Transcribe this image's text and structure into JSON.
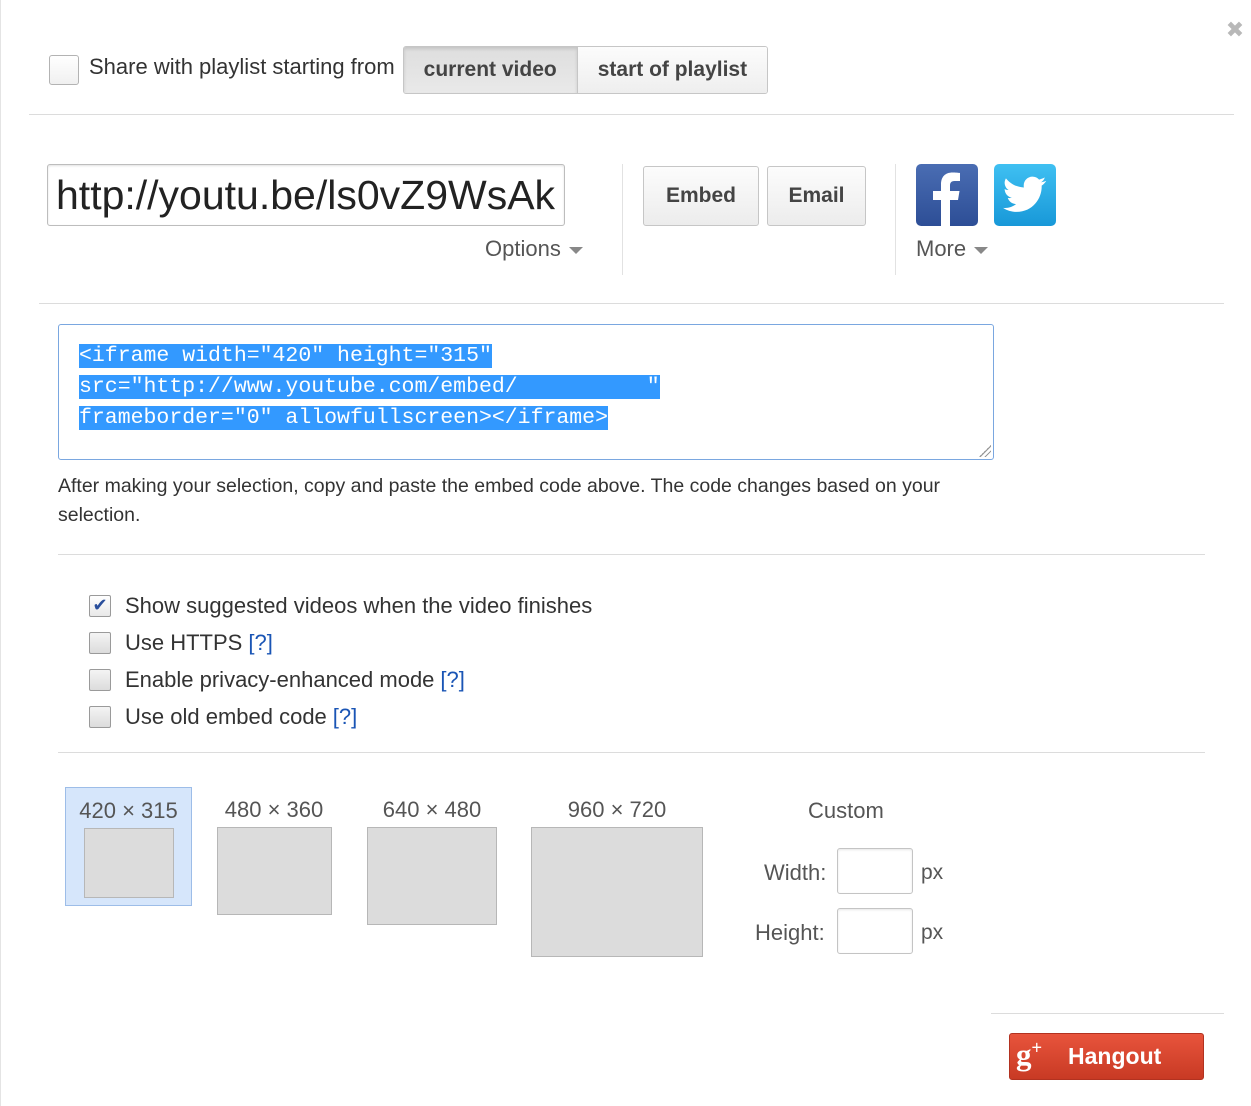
{
  "playlist": {
    "label": "Share with playlist starting from",
    "options": [
      "current video",
      "start of playlist"
    ],
    "selected": "current video"
  },
  "share": {
    "url": "http://youtu.be/ls0vZ9WsAk",
    "options_label": "Options",
    "embed_label": "Embed",
    "email_label": "Email",
    "more_label": "More"
  },
  "embed": {
    "lines": [
      "<iframe width=\"420\" height=\"315\"",
      "src=\"http://www.youtube.com/embed/          \"",
      "frameborder=\"0\" allowfullscreen></iframe>"
    ],
    "help": "After making your selection, copy and paste the embed code above. The code changes based on your selection."
  },
  "options": {
    "items": [
      {
        "label": "Show suggested videos when the video finishes",
        "checked": true,
        "help": ""
      },
      {
        "label": "Use HTTPS",
        "checked": false,
        "help": "[?]"
      },
      {
        "label": "Enable privacy-enhanced mode",
        "checked": false,
        "help": "[?]"
      },
      {
        "label": "Use old embed code",
        "checked": false,
        "help": "[?]"
      }
    ]
  },
  "sizes": {
    "presets": [
      "420 × 315",
      "480 × 360",
      "640 × 480",
      "960 × 720"
    ],
    "selected": "420 × 315",
    "custom_label": "Custom",
    "width_label": "Width:",
    "height_label": "Height:",
    "unit": "px"
  },
  "hangout": {
    "logo": "g+",
    "label": "Hangout"
  },
  "colors": {
    "selection": "#3399ff",
    "facebook": "#3b5998",
    "twitter": "#2aa9e0",
    "hangout": "#d84a32",
    "link": "#1a55b5"
  }
}
